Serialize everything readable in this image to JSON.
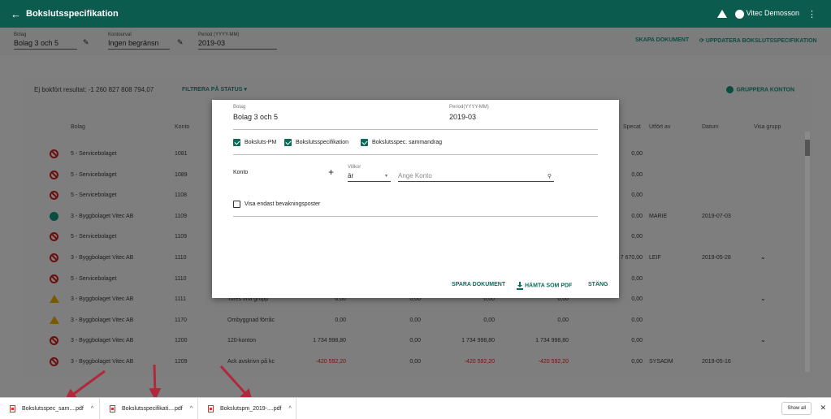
{
  "topbar": {
    "back_icon": "←",
    "title": "Bokslutsspecifikation",
    "user": "Vitec Demosson",
    "menu": "⋮"
  },
  "filters": {
    "bolag": {
      "label": "Bolag",
      "value": "Bolag 3 och 5"
    },
    "kontourval": {
      "label": "Kontourval",
      "value": "Ingen begränsn"
    },
    "period": {
      "label": "Period (YYYY-MM)",
      "value": "2019-03"
    },
    "skapa": "SKAPA DOKUMENT",
    "uppdatera": "UPPDATERA BOKSLUTSSPECIFIKATION"
  },
  "table": {
    "result_label": "Ej bokfört resultat: -1 260 827 808 794,07",
    "filter_status": "FILTRERA PÅ STATUS",
    "group_accounts": "GRUPPERA KONTON",
    "headers": {
      "bolag": "Bolag",
      "konto": "Konto",
      "specat": "Specat",
      "utfort": "Utfört av",
      "datum": "Datum",
      "visa": "Visa grupp"
    },
    "rows": [
      {
        "status": "block",
        "bolag": "5 - Servicebolaget",
        "konto": "1081",
        "namn": "",
        "a": "",
        "b": "",
        "c": "",
        "d": "",
        "spec": "0,00",
        "utfort": "",
        "datum": "",
        "chev": false
      },
      {
        "status": "block",
        "bolag": "5 - Servicebolaget",
        "konto": "1089",
        "namn": "",
        "a": "",
        "b": "",
        "c": "",
        "d": "",
        "spec": "0,00",
        "utfort": "",
        "datum": "",
        "chev": false
      },
      {
        "status": "block",
        "bolag": "5 - Servicebolaget",
        "konto": "1108",
        "namn": "",
        "a": "",
        "b": "",
        "c": "",
        "d": "",
        "spec": "0,00",
        "utfort": "",
        "datum": "",
        "chev": false
      },
      {
        "status": "ok",
        "bolag": "3 - Byggbolaget Vitec AB",
        "konto": "1109",
        "namn": "",
        "a": "",
        "b": "",
        "c": "",
        "d": "",
        "spec": "0,00",
        "utfort": "MARIE",
        "datum": "2019-07-03",
        "chev": false
      },
      {
        "status": "block",
        "bolag": "5 - Servicebolaget",
        "konto": "1109",
        "namn": "",
        "a": "",
        "b": "",
        "c": "",
        "d": "",
        "spec": "0,00",
        "utfort": "",
        "datum": "",
        "chev": false
      },
      {
        "status": "block",
        "bolag": "3 - Byggbolaget Vitec AB",
        "konto": "1110",
        "namn": "",
        "a": "",
        "b": "",
        "c": "",
        "d": "",
        "spec": "7 670,00",
        "utfort": "LEIF",
        "datum": "2019-05-28",
        "chev": true
      },
      {
        "status": "block",
        "bolag": "5 - Servicebolaget",
        "konto": "1110",
        "namn": "",
        "a": "",
        "b": "",
        "c": "",
        "d": "",
        "spec": "0,00",
        "utfort": "",
        "datum": "",
        "chev": false
      },
      {
        "status": "warn",
        "bolag": "3 - Byggbolaget Vitec AB",
        "konto": "1111",
        "namn": "Tores fina grupp",
        "a": "0,00",
        "b": "0,00",
        "c": "0,00",
        "d": "0,00",
        "spec": "0,00",
        "utfort": "",
        "datum": "",
        "chev": true
      },
      {
        "status": "warn",
        "bolag": "3 - Byggbolaget Vitec AB",
        "konto": "1170",
        "namn": "Ombyggnad förråc",
        "a": "0,00",
        "b": "0,00",
        "c": "0,00",
        "d": "0,00",
        "spec": "0,00",
        "utfort": "",
        "datum": "",
        "chev": false
      },
      {
        "status": "block",
        "bolag": "3 - Byggbolaget Vitec AB",
        "konto": "1200",
        "namn": "120-konton",
        "a": "1 734 998,80",
        "b": "0,00",
        "c": "1 734 998,80",
        "d": "1 734 998,80",
        "spec": "0,00",
        "utfort": "",
        "datum": "",
        "chev": true
      },
      {
        "status": "block",
        "bolag": "3 - Byggbolaget Vitec AB",
        "konto": "1209",
        "namn": "Ack avskrivn på kc",
        "a": "-420 592,20",
        "b": "0,00",
        "c": "-420 592,20",
        "d": "-420 592,20",
        "spec": "0,00",
        "utfort": "SYSADM",
        "datum": "2019-05-16",
        "chev": false
      }
    ]
  },
  "modal": {
    "bolag_label": "Bolag",
    "bolag_value": "Bolag 3 och 5",
    "period_label": "Period(YYYY-MM)",
    "period_value": "2019-03",
    "cb1": "Boksluts-PM",
    "cb2": "Bokslutsspecifikation",
    "cb3": "Bokslutsspec. sammandrag",
    "konto_label": "Konto",
    "plus": "+",
    "villkor_label": "Villkor",
    "villkor_value": "är",
    "konto_placeholder": "Ange Konto",
    "visa_label": "Visa endast bevakningsposter",
    "btn_save": "SPARA DOKUMENT",
    "btn_pdf": "HÄMTA SOM PDF",
    "btn_close": "STÄNG"
  },
  "downloads": {
    "items": [
      "Bokslutsspec_sam....pdf",
      "Bokslutsspecifikati....pdf",
      "Bokslutspm_2019-....pdf"
    ],
    "caret": "^",
    "show_all": "Show all",
    "close": "✕"
  },
  "colors": {
    "header_green": "#0b5c4e",
    "accent": "#0b6b5a",
    "block_red": "#6b0f0f",
    "warn_amber": "#7a5a00"
  }
}
